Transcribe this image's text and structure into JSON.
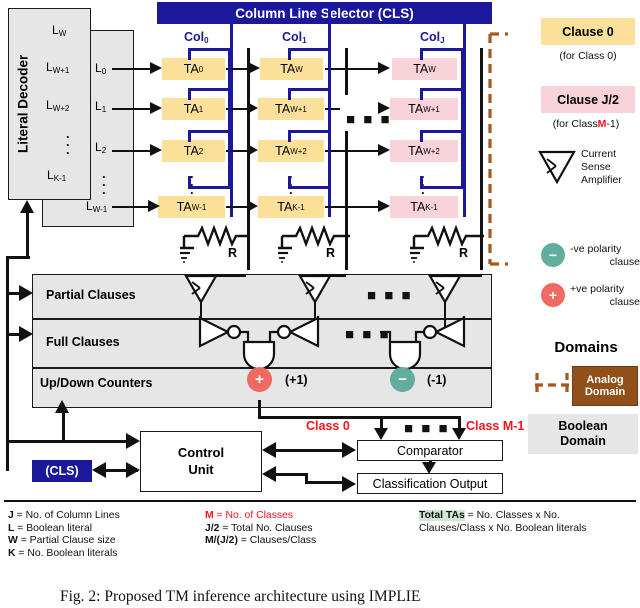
{
  "figure": {
    "caption": "Fig. 2: Proposed TM inference architecture using IMPLIE",
    "title": "Proposed TM inference architecture"
  },
  "cls": {
    "header": "Column Line Selector (CLS)",
    "chip_label": "(CLS)"
  },
  "literal_decoder": {
    "label": "Literal Decoder",
    "inner_literals": [
      "L",
      "L",
      "L",
      "L"
    ],
    "inner_subs": [
      "W",
      "W+1",
      "W+2",
      "K-1"
    ],
    "outer_literals": [
      {
        "base": "L",
        "sub": "0"
      },
      {
        "base": "L",
        "sub": "1"
      },
      {
        "base": "L",
        "sub": "2"
      },
      {
        "base": "L",
        "sub": "W-1"
      }
    ]
  },
  "columns": [
    {
      "name": "Col",
      "sub": "0",
      "color": "yellow",
      "resistor_label": "R",
      "cells": [
        {
          "base": "TA",
          "sub": "0"
        },
        {
          "base": "TA",
          "sub": "1"
        },
        {
          "base": "TA",
          "sub": "2"
        },
        {
          "base": "TA",
          "sub": "W-1"
        }
      ]
    },
    {
      "name": "Col",
      "sub": "1",
      "color": "yellow",
      "resistor_label": "R",
      "cells": [
        {
          "base": "TA",
          "sub": "W"
        },
        {
          "base": "TA",
          "sub": "W+1"
        },
        {
          "base": "TA",
          "sub": "W+2"
        },
        {
          "base": "TA",
          "sub": "K-1"
        }
      ]
    },
    {
      "name": "Col",
      "sub": "J",
      "color": "pink",
      "resistor_label": "R",
      "cells": [
        {
          "base": "TA",
          "sub": "W"
        },
        {
          "base": "TA",
          "sub": "W+1"
        },
        {
          "base": "TA",
          "sub": "W+2"
        },
        {
          "base": "TA",
          "sub": "K-1"
        }
      ]
    }
  ],
  "rows": {
    "partial_clauses": "Partial Clauses",
    "full_clauses": "Full Clauses",
    "counters": "Up/Down Counters",
    "counter_pos": "(+1)",
    "counter_neg": "(-1)",
    "pos_glyph": "+",
    "neg_glyph": "−"
  },
  "control": {
    "unit_line1": "Control",
    "unit_line2": "Unit",
    "comparator": "Comparator",
    "classification_output": "Classification Output",
    "class_first": "Class 0",
    "class_last": "Class M-1"
  },
  "legend": {
    "clause0_title": "Clause 0",
    "clause0_sub": "(for Class 0)",
    "clausej_title": "Clause J/2",
    "clausej_sub_pre": "(for Class ",
    "clausej_sub_m": "M",
    "clausej_sub_post": "-1)",
    "csa_lines": [
      "Current",
      "Sense",
      "Amplifier"
    ],
    "neg_polarity": [
      "-ve polarity",
      "clause"
    ],
    "pos_polarity": [
      "+ve polarity",
      "clause"
    ],
    "domains_title": "Domains",
    "analog_domain": [
      "Analog",
      "Domain"
    ],
    "boolean_domain": [
      "Boolean",
      "Domain"
    ]
  },
  "notes": {
    "col1": [
      {
        "sym": "J",
        "rest": " = No. of Column Lines"
      },
      {
        "sym": "L",
        "rest": " = Boolean literal"
      },
      {
        "sym": "W",
        "rest": " = Partial Clause size"
      },
      {
        "sym": "K",
        "rest": " = No. Boolean literals"
      }
    ],
    "col2": [
      {
        "sym": "M",
        "rest": " = No. of Classes",
        "red": true
      },
      {
        "sym": "J/2",
        "rest": " = Total No. Clauses",
        "red": false
      },
      {
        "sym": "M/(J/2)",
        "rest": " = Clauses/Class",
        "red": false
      }
    ],
    "col3_sym": "Total TAs",
    "col3_line1": " = No. Classes x No.",
    "col3_line2": "Clauses/Class x No. Boolean literals"
  },
  "colors": {
    "navy": "#1b189c",
    "yellow": "#fbe09a",
    "pink": "#f8d4da",
    "red": "#f5141b",
    "teal": "#63ad9f",
    "salmon": "#ef6b61",
    "brown": "#91501a",
    "gray": "#e6e6e6"
  }
}
